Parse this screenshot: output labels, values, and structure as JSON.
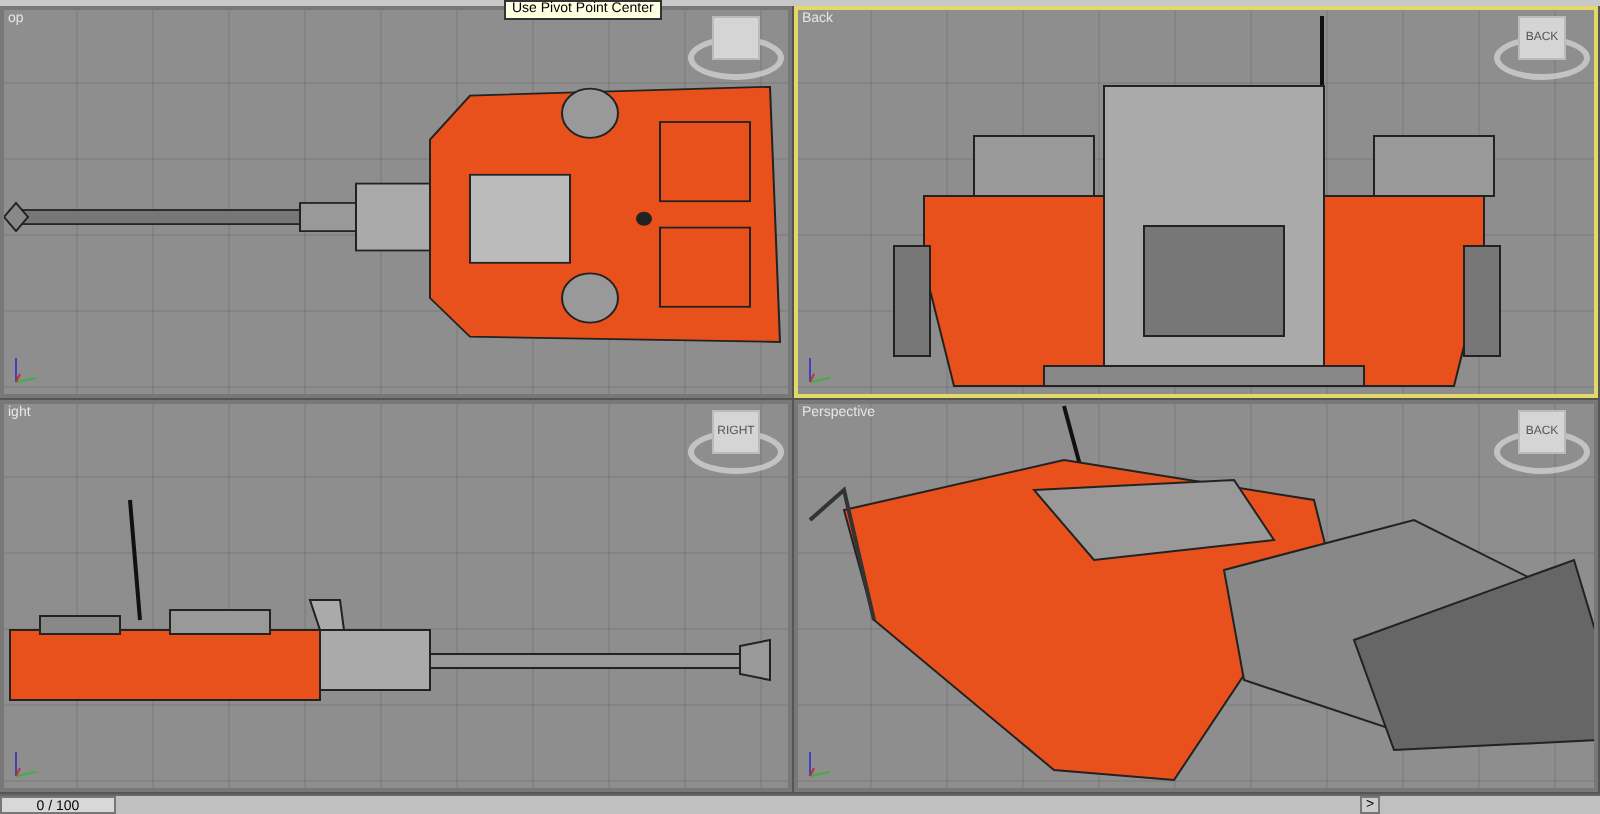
{
  "tooltip": "Use Pivot Point Center",
  "viewports": [
    {
      "label": "op",
      "kind": "top",
      "active": false
    },
    {
      "label": "Back",
      "kind": "back",
      "active": true,
      "viewcube_label": "BACK"
    },
    {
      "label": "ight",
      "kind": "right",
      "active": false,
      "viewcube_label": "RIGHT"
    },
    {
      "label": "Perspective",
      "kind": "perspective",
      "active": false,
      "viewcube_label": "BACK"
    }
  ],
  "timeline": {
    "frame": "0 / 100",
    "level": 0,
    "next_button": ">"
  }
}
